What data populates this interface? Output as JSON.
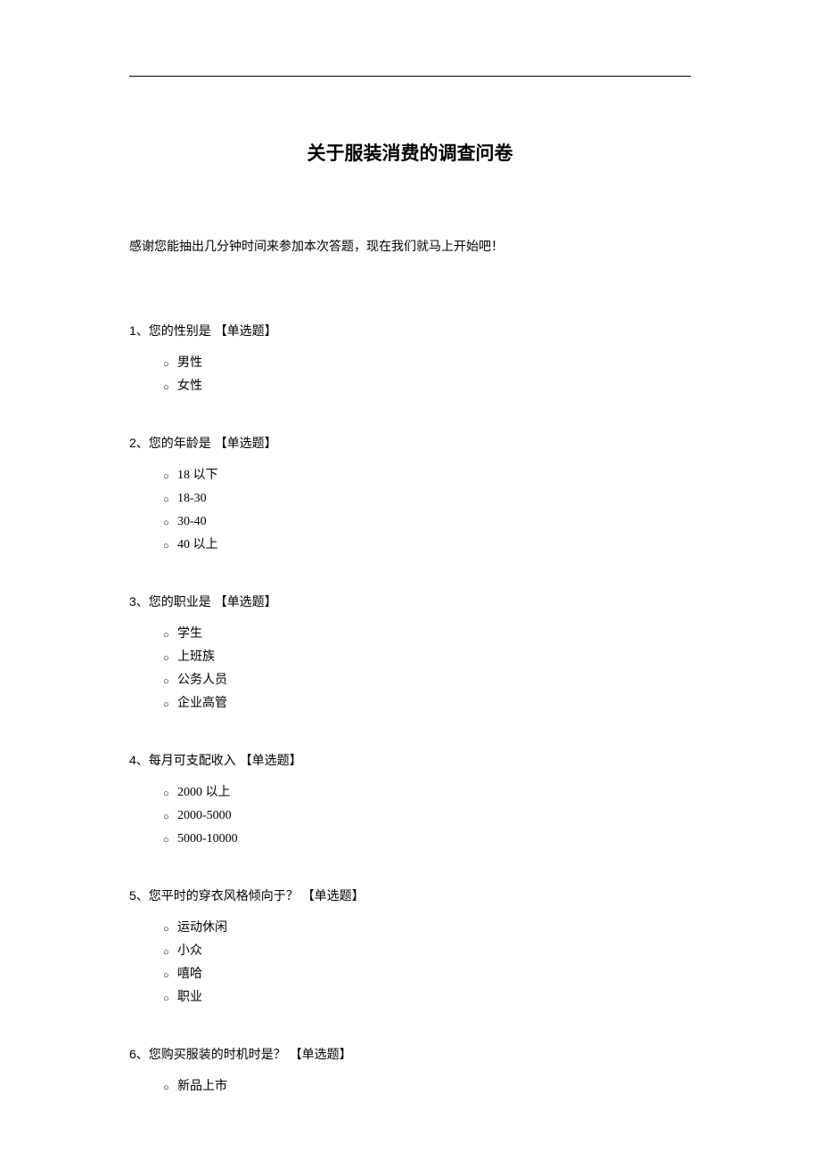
{
  "title": "关于服装消费的调查问卷",
  "intro": "感谢您能抽出几分钟时间来参加本次答题，现在我们就马上开始吧！",
  "questions": [
    {
      "number": "1、",
      "text": "您的性别是 ",
      "type": "【单选题】",
      "options": [
        "男性",
        "女性"
      ]
    },
    {
      "number": "2、",
      "text": "您的年龄是 ",
      "type": "【单选题】",
      "options": [
        "18 以下",
        "18-30",
        "30-40",
        "40 以上"
      ]
    },
    {
      "number": "3、",
      "text": "您的职业是 ",
      "type": "【单选题】",
      "options": [
        "学生",
        "上班族",
        "公务人员",
        "企业高管"
      ]
    },
    {
      "number": "4、",
      "text": "每月可支配收入 ",
      "type": "【单选题】",
      "options": [
        "2000 以上",
        "2000-5000",
        "5000-10000"
      ]
    },
    {
      "number": "5、",
      "text": "您平时的穿衣风格倾向于？  ",
      "type": "【单选题】",
      "options": [
        "运动休闲",
        "小众",
        "嘻哈",
        "职业"
      ]
    },
    {
      "number": "6、",
      "text": "您购买服装的时机时是？  ",
      "type": "【单选题】",
      "options": [
        "新品上市"
      ]
    }
  ]
}
